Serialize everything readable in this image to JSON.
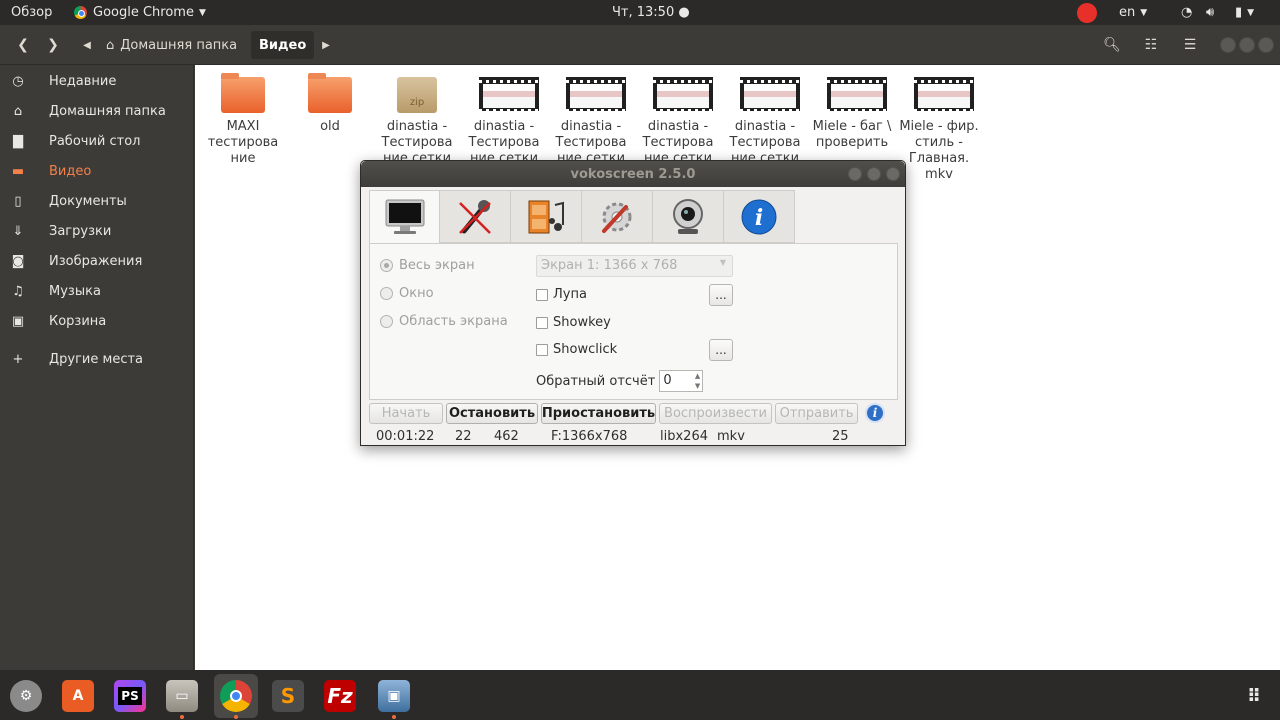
{
  "topbar": {
    "activities": "Обзор",
    "app": "Google Chrome",
    "clock": "Чт, 13:50 ●",
    "lang": "en"
  },
  "nautilus": {
    "breadcrumb_home": "Домашняя папка",
    "breadcrumb_current": "Видео",
    "sidebar": [
      {
        "label": "Недавние",
        "icon": "clock-icon"
      },
      {
        "label": "Домашняя папка",
        "icon": "home-icon"
      },
      {
        "label": "Рабочий стол",
        "icon": "desktop-icon"
      },
      {
        "label": "Видео",
        "icon": "video-icon"
      },
      {
        "label": "Документы",
        "icon": "document-icon"
      },
      {
        "label": "Загрузки",
        "icon": "download-icon"
      },
      {
        "label": "Изображения",
        "icon": "camera-icon"
      },
      {
        "label": "Музыка",
        "icon": "music-icon"
      },
      {
        "label": "Корзина",
        "icon": "trash-icon"
      },
      {
        "label": "Другие места",
        "icon": "plus-icon"
      }
    ],
    "files": [
      {
        "name": "MAXI тестирова ние",
        "kind": "folder"
      },
      {
        "name": "old",
        "kind": "folder"
      },
      {
        "name": "dinastia - Тестирова ние сетки",
        "kind": "zip"
      },
      {
        "name": "dinastia - Тестирова ние сетки",
        "kind": "video"
      },
      {
        "name": "dinastia - Тестирова ние сетки",
        "kind": "video"
      },
      {
        "name": "dinastia - Тестирова ние сетки",
        "kind": "video"
      },
      {
        "name": "dinastia - Тестирова ние сетки",
        "kind": "video"
      },
      {
        "name": "Miele - баг \\ проверить",
        "kind": "video"
      },
      {
        "name": "Miele - фир. стиль - Главная. mkv",
        "kind": "video"
      }
    ]
  },
  "vokoscreen": {
    "title": "vokoscreen 2.5.0",
    "radios": [
      "Весь экран",
      "Окно",
      "Область экрана"
    ],
    "screen_combo": "Экран 1:  1366 x 768",
    "checkboxes": [
      "Лупа",
      "Showkey",
      "Showclick"
    ],
    "dots": "...",
    "countdown_label": "Обратный отсчёт",
    "countdown_value": "0",
    "buttons": {
      "start": "Начать",
      "stop": "Остановить",
      "pause": "Приостановить",
      "play": "Воспроизвести",
      "send": "Отправить"
    },
    "status": {
      "time": "00:01:22",
      "fps": "22",
      "frames": "462",
      "format": "F:1366x768",
      "codec": "libx264",
      "container": "mkv",
      "rate": "25"
    }
  },
  "dock": [
    "settings-app",
    "software-center",
    "phpstorm",
    "file-manager",
    "chrome",
    "sublime-text",
    "filezilla",
    "vokoscreen"
  ]
}
